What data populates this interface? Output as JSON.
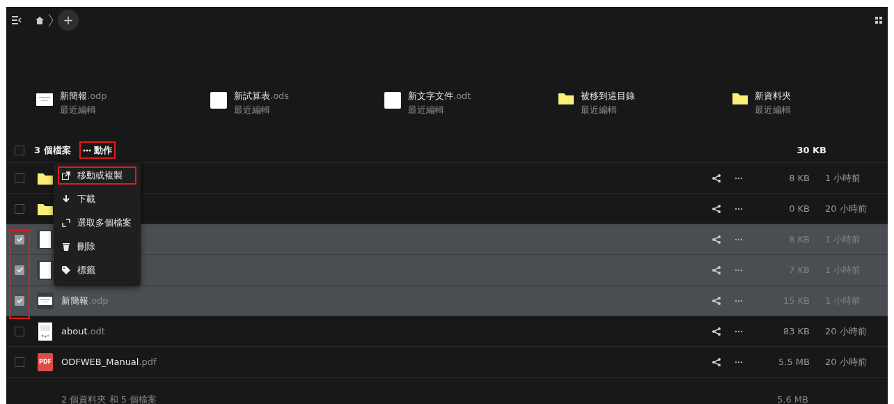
{
  "header": {
    "add_button": {
      "label": "+"
    }
  },
  "recent": [
    {
      "kind": "presentation",
      "name": "新簡報",
      "ext": ".odp",
      "subtitle": "最近編輯"
    },
    {
      "kind": "sheet",
      "name": "新試算表",
      "ext": ".ods",
      "subtitle": "最近編輯"
    },
    {
      "kind": "text",
      "name": "新文字文件",
      "ext": ".odt",
      "subtitle": "最近編輯"
    },
    {
      "kind": "folder",
      "name": "被移到這目錄",
      "subtitle": "最近編輯"
    },
    {
      "kind": "folder",
      "name": "新資料夾",
      "subtitle": "最近編輯"
    }
  ],
  "table": {
    "select_all_checked": false,
    "selection_label": "3 個檔案",
    "actions_button": {
      "label": "動作",
      "highlighted": true
    },
    "total_size": "30 KB",
    "checkbox_column_highlighted": true,
    "rows": [
      {
        "kind": "folder",
        "selected": false,
        "size": "8 KB",
        "modified": "1 小時前"
      },
      {
        "kind": "folder",
        "selected": false,
        "size": "0 KB",
        "modified": "20 小時前"
      },
      {
        "kind": "text",
        "selected": true,
        "size": "8 KB",
        "modified": "1 小時前"
      },
      {
        "kind": "text",
        "selected": true,
        "size": "7 KB",
        "modified": "1 小時前"
      },
      {
        "kind": "presentation",
        "name": "新簡報",
        "ext": ".odp",
        "selected": true,
        "size": "15 KB",
        "modified": "1 小時前"
      },
      {
        "kind": "document",
        "name": "about",
        "ext": ".odt",
        "selected": false,
        "size": "83 KB",
        "modified": "20 小時前"
      },
      {
        "kind": "pdf",
        "badge": "PDF",
        "name": "ODFWEB_Manual",
        "ext": ".pdf",
        "selected": false,
        "size": "5.5 MB",
        "modified": "20 小時前"
      }
    ]
  },
  "actions_menu": [
    {
      "kind": "move",
      "label": "移動或複製",
      "highlighted": true
    },
    {
      "kind": "download",
      "label": "下載",
      "highlighted": false
    },
    {
      "kind": "select",
      "label": "選取多個檔案",
      "highlighted": false
    },
    {
      "kind": "delete",
      "label": "刪除",
      "highlighted": false
    },
    {
      "kind": "tag",
      "label": "標籤",
      "highlighted": false
    }
  ],
  "footer": {
    "summary": "2 個資料夾 和 5 個檔案",
    "total": "5.6 MB"
  }
}
